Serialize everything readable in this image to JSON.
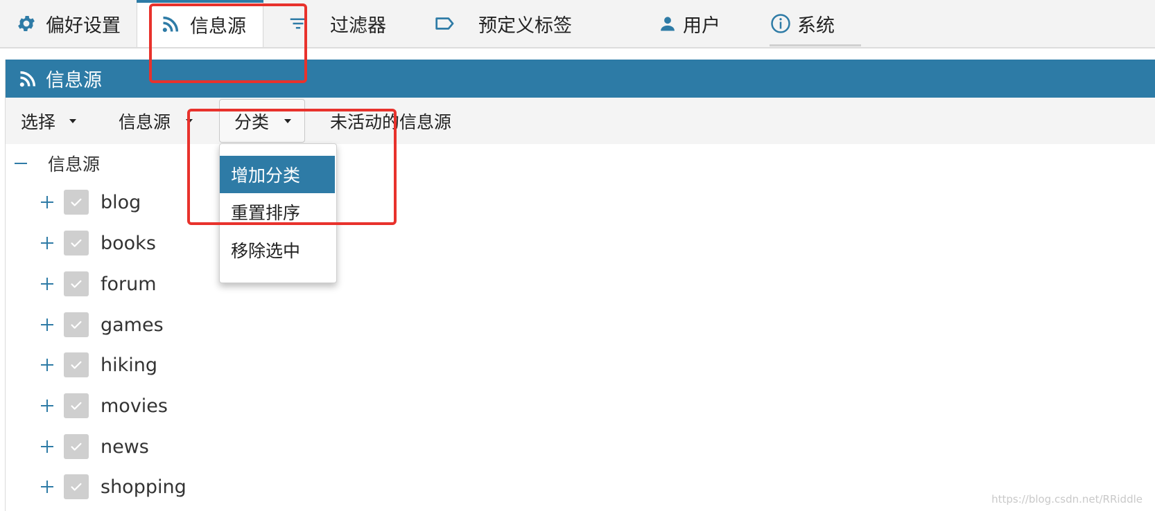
{
  "tabs": [
    {
      "label": "偏好设置",
      "icon": "gear-icon",
      "active": false
    },
    {
      "label": "信息源",
      "icon": "rss-icon",
      "active": true
    },
    {
      "label": "过滤器",
      "icon": "filter-icon",
      "active": false
    },
    {
      "label": "预定义标签",
      "icon": "label-icon",
      "active": false
    },
    {
      "label": "用户",
      "icon": "user-icon",
      "active": false
    },
    {
      "label": "系统",
      "icon": "info-icon",
      "active": false
    }
  ],
  "panel": {
    "title": "信息源",
    "icon": "rss-icon"
  },
  "toolbar": {
    "select_label": "选择",
    "feeds_label": "信息源",
    "categories_label": "分类",
    "inactive_label": "未活动的信息源"
  },
  "dropdown": {
    "items": [
      {
        "label": "增加分类",
        "highlighted": true
      },
      {
        "label": "重置排序",
        "highlighted": false
      },
      {
        "label": "移除选中",
        "highlighted": false
      }
    ]
  },
  "tree": {
    "root_label": "信息源",
    "items": [
      {
        "label": "blog",
        "checked": true
      },
      {
        "label": "books",
        "checked": true
      },
      {
        "label": "forum",
        "checked": true
      },
      {
        "label": "games",
        "checked": true
      },
      {
        "label": "hiking",
        "checked": true
      },
      {
        "label": "movies",
        "checked": true
      },
      {
        "label": "news",
        "checked": true
      },
      {
        "label": "shopping",
        "checked": true
      }
    ]
  },
  "watermark": "https://blog.csdn.net/RRiddle",
  "colors": {
    "accent": "#2e7ba6",
    "annotation": "#e8322c",
    "checkbox": "#cfcfcf"
  }
}
